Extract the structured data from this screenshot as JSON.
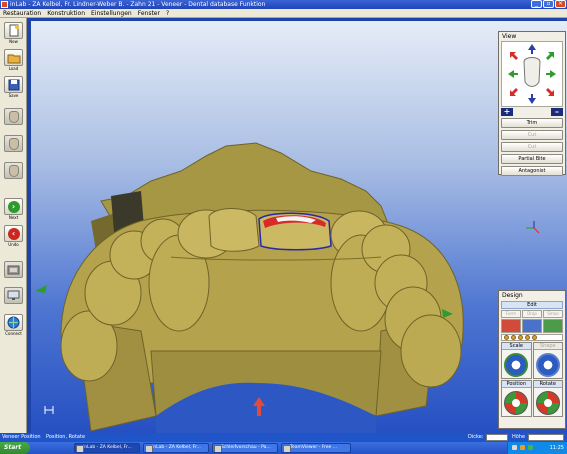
{
  "window": {
    "title": "inLab - ZA Kelbel, Fr. Lindner-Weber B. - Zahn  21 - Veneer - Dental database Funktion"
  },
  "menu": {
    "items": [
      "Restauration",
      "Konstruktion",
      "Einstellungen",
      "Fenster",
      "?"
    ]
  },
  "toolbar": {
    "items": [
      {
        "label": "New",
        "icon": "new-document-icon"
      },
      {
        "label": "Load",
        "icon": "folder-icon"
      },
      {
        "label": "Save",
        "icon": "floppy-disk-icon"
      },
      {
        "label": "",
        "icon": "tooth-icon"
      },
      {
        "label": "",
        "icon": "tooth-icon"
      },
      {
        "label": "",
        "icon": "tooth-icon"
      },
      {
        "label": "Next",
        "icon": "next-arrow-icon"
      },
      {
        "label": "Undo",
        "icon": "undo-arrow-icon"
      },
      {
        "label": "",
        "icon": "scan-icon"
      },
      {
        "label": "",
        "icon": "monitor-icon"
      },
      {
        "label": "Connect",
        "icon": "connect-globe-icon"
      }
    ]
  },
  "view_panel": {
    "title": "View",
    "zoom_in": "+",
    "zoom_out": "–",
    "buttons": [
      {
        "label": "Trim",
        "enabled": true
      },
      {
        "label": "Cut",
        "enabled": false
      },
      {
        "label": "Cut",
        "enabled": false
      },
      {
        "label": "Partial Bite",
        "enabled": true
      },
      {
        "label": "Antagonist",
        "enabled": true
      }
    ]
  },
  "design_panel": {
    "title": "Design",
    "edit_label": "Edit",
    "edit_row1": [
      "Form",
      "Drop",
      "Smoo"
    ],
    "tools": [
      {
        "label": "Scale",
        "enabled": true
      },
      {
        "label": "Shape",
        "enabled": false
      },
      {
        "label": "Position",
        "enabled": true
      },
      {
        "label": "Rotate",
        "enabled": true
      }
    ]
  },
  "statusbar": {
    "left": "Veneer Position",
    "mid": "Position, Rotate",
    "thickness_label": "Dicke:",
    "height_label": "Höhe"
  },
  "taskbar": {
    "start": "Start",
    "tasks": [
      "inLab - ZA Kelbel, Fr...",
      "inLab - ZA Kelbel, Fr...",
      "Schleifvorschau - Pa...",
      "TeamViewer - Free ..."
    ],
    "clock": "11:25"
  },
  "colors": {
    "model": "#b5a24c",
    "restoration": "#d92a2a",
    "margin_line": "#2a2aa8",
    "background_top": "#e5ecf6",
    "background_bottom": "#2650c2"
  }
}
